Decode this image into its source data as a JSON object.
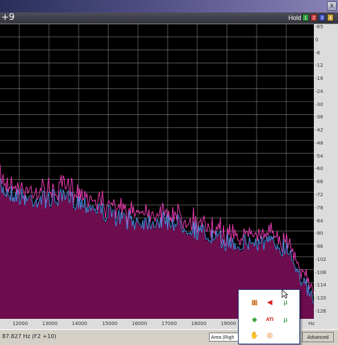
{
  "window": {
    "close_label": "x"
  },
  "header": {
    "offset_label": "+9",
    "hold_label": "Hold",
    "hold_buttons": [
      {
        "label": "1",
        "color": "#2f9a3a"
      },
      {
        "label": "2",
        "color": "#c23434"
      },
      {
        "label": "3",
        "color": "#3c4bb8"
      },
      {
        "label": "4",
        "color": "#c9a23a"
      }
    ]
  },
  "db_scale": [
    "-65",
    "0",
    "-6",
    "-12",
    "-18",
    "-24",
    "-30",
    "-36",
    "-42",
    "-48",
    "-54",
    "-60",
    "-66",
    "-72",
    "-78",
    "-84",
    "-90",
    "-96",
    "-102",
    "-108",
    "-114",
    "-120",
    "-126"
  ],
  "freq_axis": {
    "labels": [
      "12000",
      "13000",
      "14000",
      "15000",
      "16000",
      "17000",
      "18000",
      "19000",
      "Hz"
    ]
  },
  "spectrum": {
    "fill_color": "#6e0d4e",
    "peak_color": "#f13cb8",
    "trace_color": "#3f8fe0",
    "grid_color": "#8a8a8a"
  },
  "status": {
    "text": "87.827 Hz (F2 +10)",
    "area_value": "Area (Righ",
    "advanced_label": "Advanced"
  },
  "tray": {
    "icons": [
      {
        "name": "server-icon",
        "glyph": "▦",
        "color": "#c05a00"
      },
      {
        "name": "speaker-icon",
        "glyph": "◀",
        "color": "#d22"
      },
      {
        "name": "utorrent-update-icon",
        "glyph": "µ",
        "color": "#1d8a2a"
      },
      {
        "name": "chat-icon",
        "glyph": "◆",
        "color": "#3ea83e"
      },
      {
        "name": "ati-icon",
        "glyph": "ATI",
        "color": "#d10f0f"
      },
      {
        "name": "utorrent-icon",
        "glyph": "µ",
        "color": "#1d8a2a"
      },
      {
        "name": "hand-icon",
        "glyph": "✋",
        "color": "#b86a00"
      },
      {
        "name": "lifebuoy-icon",
        "glyph": "◎",
        "color": "#e06a00"
      }
    ]
  }
}
